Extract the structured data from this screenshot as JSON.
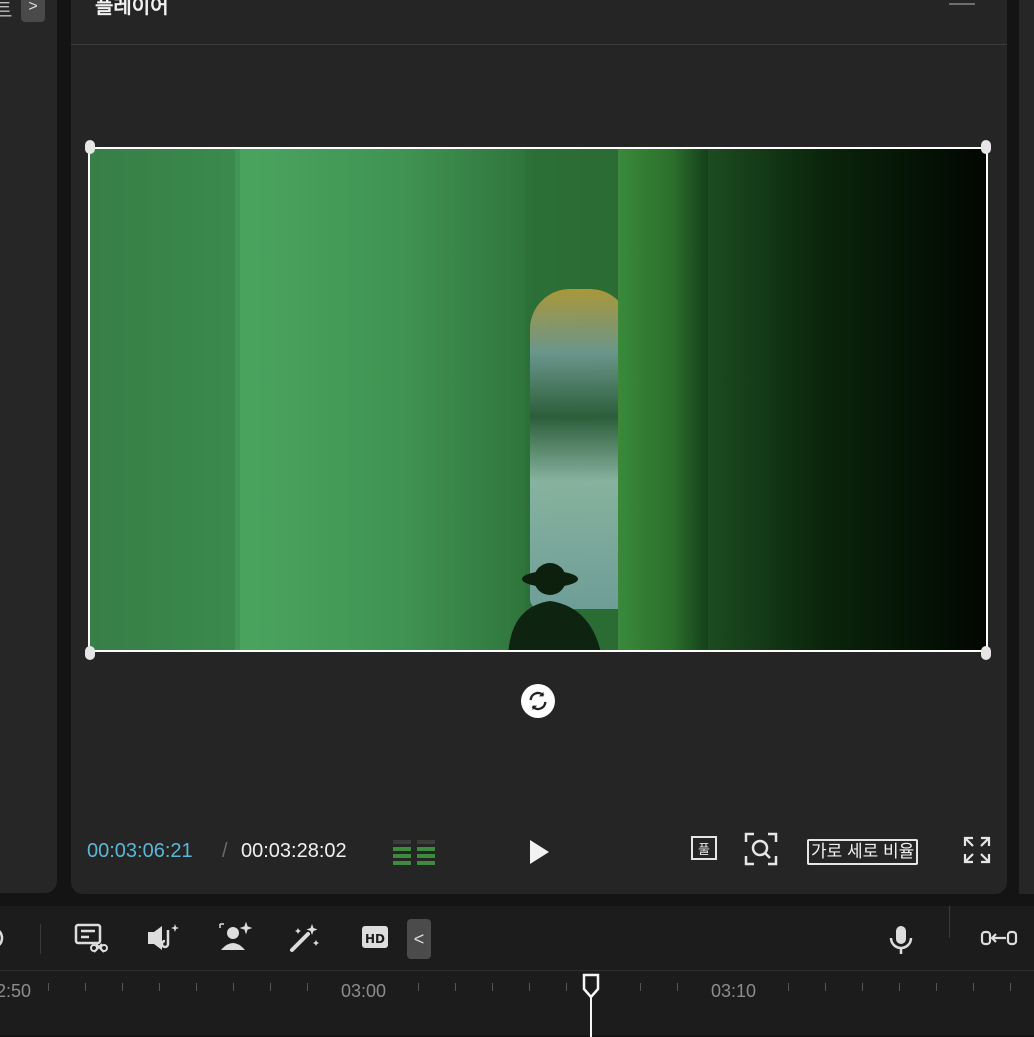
{
  "left_panel": {
    "cut_glyph": "트",
    "expand_label": ">"
  },
  "player": {
    "title": "플레이어",
    "current_time": "00:03:06:21",
    "separator": "/",
    "total_time": "00:03:28:02",
    "ratio_label": "가로 세로 비율",
    "quality_icon": "full-quality-icon"
  },
  "toolbar": {
    "collapse_label": "<",
    "icons": [
      "split-icon",
      "remove-bg-icon",
      "audio-enhance-icon",
      "ai-person-icon",
      "magic-wand-icon",
      "hd-icon",
      "microphone-icon",
      "link-icon"
    ]
  },
  "timeline": {
    "labels": [
      "2:50",
      "03:00",
      "03:10"
    ]
  },
  "colors": {
    "accent_timecode": "#5bb7d6",
    "panel_bg": "#252525",
    "app_bg": "#141414"
  }
}
